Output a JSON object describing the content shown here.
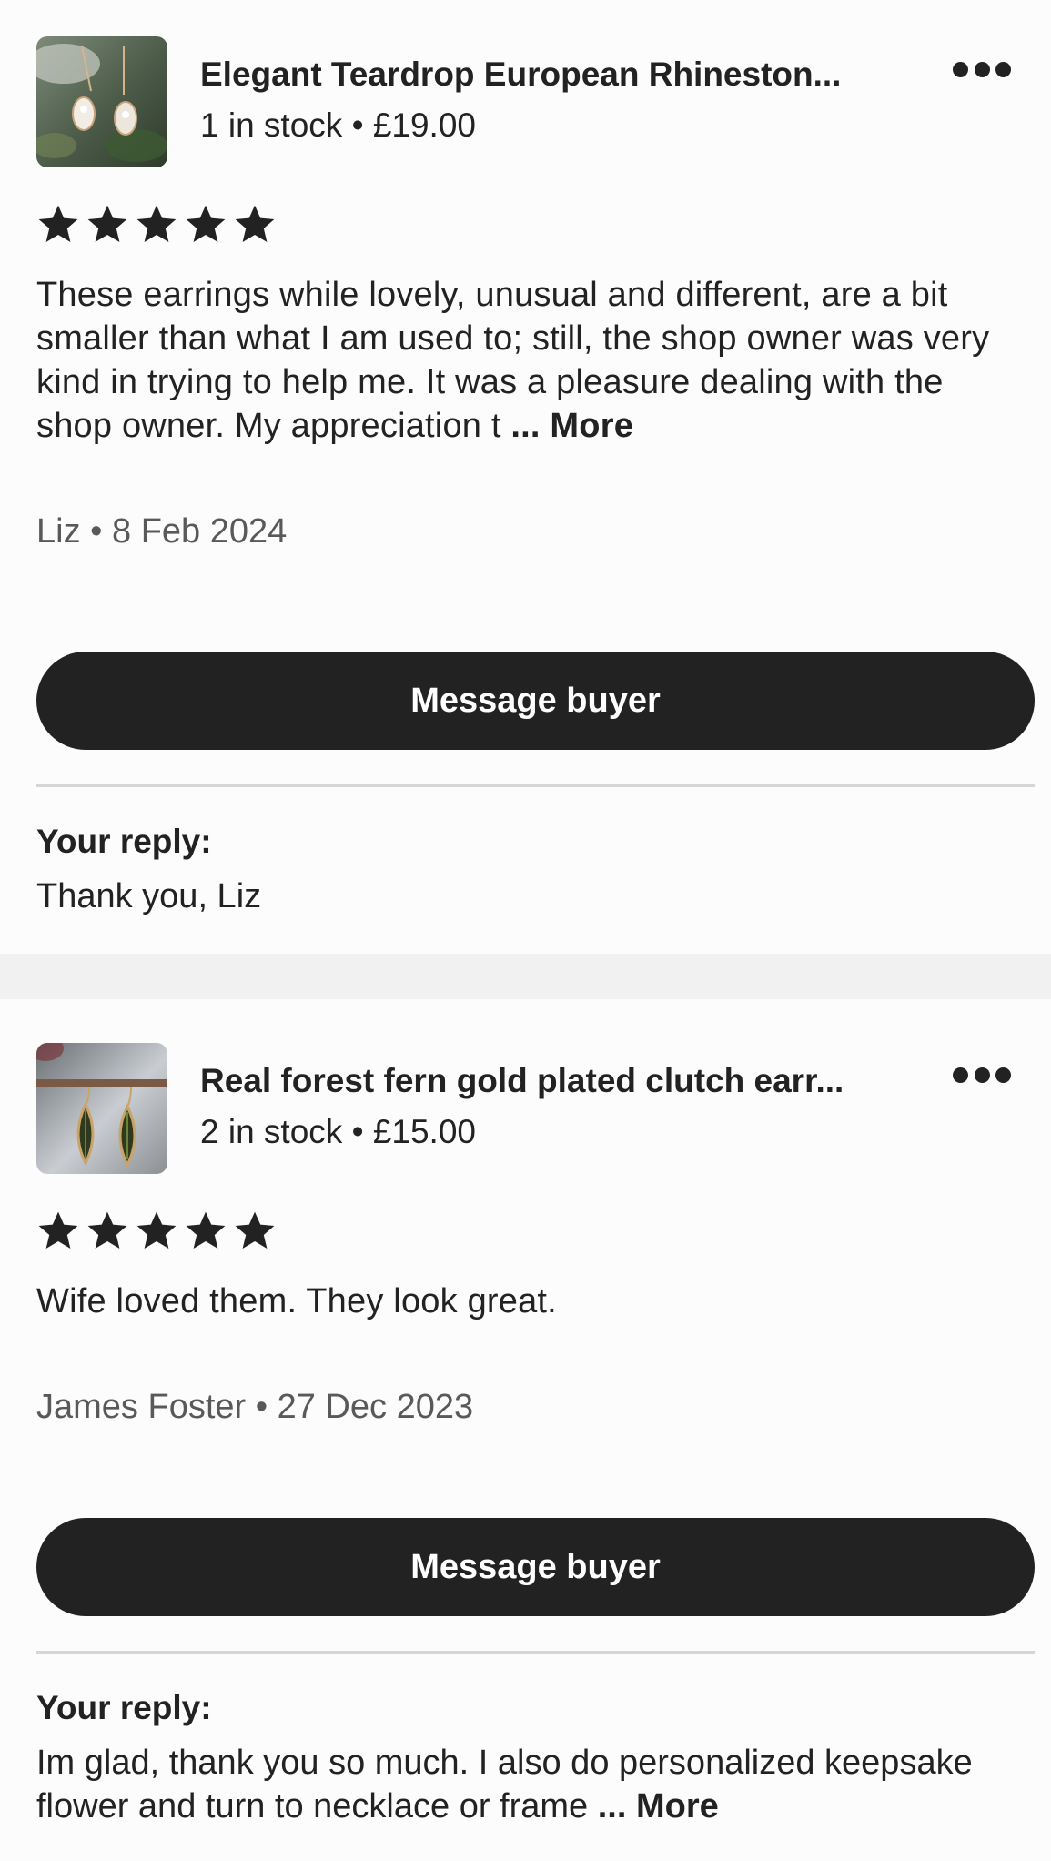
{
  "reviews": [
    {
      "listing_title": "Elegant Teardrop European Rhineston...",
      "stock": "1 in stock",
      "price": "£19.00",
      "rating": 5,
      "review_text": "These earrings while lovely, unusual and different, are a bit smaller than what I am used to; still, the shop owner was very kind in trying to help me.  It was a pleasure dealing with the shop owner.  My appreciation t",
      "more_label": "... More",
      "reviewer": "Liz",
      "date": "8 Feb 2024",
      "button_label": "Message buyer",
      "reply_label": "Your reply:",
      "reply_text": "Thank you, Liz",
      "reply_more": ""
    },
    {
      "listing_title": "Real forest fern gold plated clutch earr...",
      "stock": "2 in stock",
      "price": "£15.00",
      "rating": 5,
      "review_text": "Wife loved them. They look great.",
      "more_label": "",
      "reviewer": "James Foster",
      "date": "27 Dec 2023",
      "button_label": "Message buyer",
      "reply_label": "Your reply:",
      "reply_text": "Im glad, thank you so much. I also do personalized keepsake flower and  turn  to necklace or frame",
      "reply_more": "... More"
    }
  ],
  "separator": "•",
  "colors": {
    "text": "#222222",
    "muted": "#595959",
    "button_bg": "#222222",
    "button_text": "#ffffff",
    "divider": "#d6d6d6",
    "page_bg": "#f1f1f1"
  },
  "icons": {
    "more_menu": "more-horizontal-icon",
    "star": "star-filled-icon"
  }
}
